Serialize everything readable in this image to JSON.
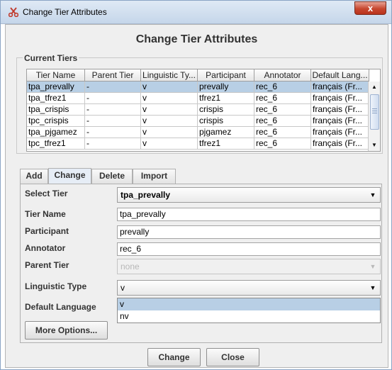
{
  "window": {
    "title": "Change Tier Attributes",
    "close_label": "x"
  },
  "dialog": {
    "heading": "Change Tier Attributes"
  },
  "current_tiers": {
    "legend": "Current Tiers",
    "columns": [
      "Tier Name",
      "Parent Tier",
      "Linguistic Ty...",
      "Participant",
      "Annotator",
      "Default Lang..."
    ],
    "rows": [
      [
        "tpa_prevally",
        "-",
        "v",
        "prevally",
        "rec_6",
        "français (Fr..."
      ],
      [
        "tpa_tfrez1",
        "-",
        "v",
        "tfrez1",
        "rec_6",
        "français (Fr..."
      ],
      [
        "tpa_crispis",
        "-",
        "v",
        "crispis",
        "rec_6",
        "français (Fr..."
      ],
      [
        "tpc_crispis",
        "-",
        "v",
        "crispis",
        "rec_6",
        "français (Fr..."
      ],
      [
        "tpa_pjgamez",
        "-",
        "v",
        "pjgamez",
        "rec_6",
        "français (Fr..."
      ],
      [
        "tpc_tfrez1",
        "-",
        "v",
        "tfrez1",
        "rec_6",
        "français (Fr..."
      ]
    ],
    "selected_row": 0
  },
  "tabs": [
    {
      "label": "Add"
    },
    {
      "label": "Change"
    },
    {
      "label": "Delete"
    },
    {
      "label": "Import"
    }
  ],
  "active_tab": "Change",
  "form": {
    "select_tier": {
      "label": "Select Tier",
      "value": "tpa_prevally"
    },
    "tier_name": {
      "label": "Tier Name",
      "value": "tpa_prevally"
    },
    "participant": {
      "label": "Participant",
      "value": "prevally"
    },
    "annotator": {
      "label": "Annotator",
      "value": "rec_6"
    },
    "parent_tier": {
      "label": "Parent Tier",
      "value": "none"
    },
    "linguistic_type": {
      "label": "Linguistic Type",
      "value": "v",
      "options": [
        "v",
        "nv"
      ],
      "highlighted_option": "v"
    },
    "default_language": {
      "label": "Default Language"
    },
    "more_options_label": "More Options..."
  },
  "buttons": {
    "change_label": "Change",
    "close_label": "Close"
  },
  "colors": {
    "selection": "#b8cfe5",
    "title_bar": "#c5d6ea",
    "close_button": "#c7472f",
    "panel": "#efefef"
  },
  "icons": {
    "app": "scissors-app-icon",
    "dropdown": "chevron-down-icon"
  }
}
